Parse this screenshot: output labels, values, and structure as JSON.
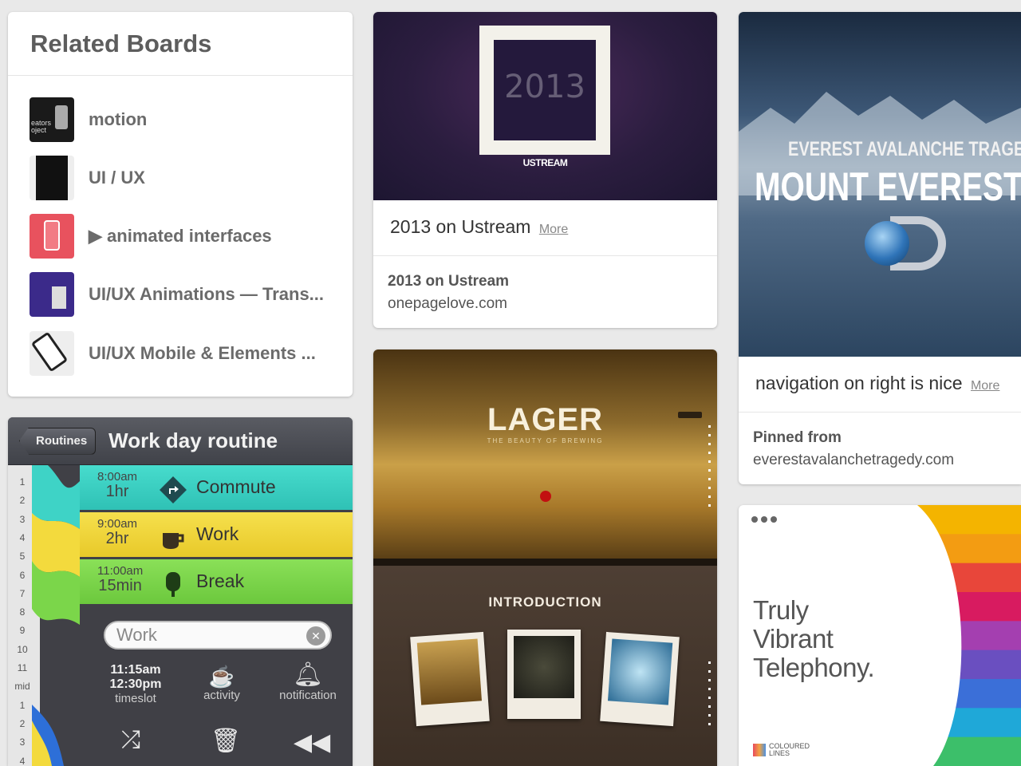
{
  "related_boards": {
    "title": "Related Boards",
    "items": [
      {
        "label": "motion",
        "thumb_text": "eators\noject"
      },
      {
        "label": "UI / UX"
      },
      {
        "label": "▶ animated interfaces"
      },
      {
        "label": "UI/UX Animations — Trans..."
      },
      {
        "label": "UI/UX Mobile & Elements ..."
      }
    ]
  },
  "routine": {
    "back_label": "Routines",
    "title": "Work day routine",
    "ruler": [
      "1",
      "2",
      "3",
      "4",
      "5",
      "6",
      "7",
      "8",
      "9",
      "10",
      "11",
      "mid",
      "1",
      "2",
      "3",
      "4"
    ],
    "rows": [
      {
        "time": "8:00am",
        "duration": "1hr",
        "name": "Commute",
        "color": "#3ed3c6"
      },
      {
        "time": "9:00am",
        "duration": "2hr",
        "name": "Work",
        "color": "#f3da3d"
      },
      {
        "time": "11:00am",
        "duration": "15min",
        "name": "Break",
        "color": "#7bd64a"
      }
    ],
    "search_value": "Work",
    "timeslot_start": "11:15am",
    "timeslot_end": "12:30pm",
    "timeslot_label": "timeslot",
    "activity_label": "activity",
    "notification_label": "notification"
  },
  "ustream": {
    "image_year": "2013",
    "image_logo": "USTREAM",
    "caption": "2013 on Ustream",
    "more": "More",
    "source_title": "2013 on Ustream",
    "source_domain": "onepagelove.com"
  },
  "lager": {
    "title": "LAGER",
    "subtitle": "THE BEAUTY OF BREWING",
    "intro": "INTRODUCTION"
  },
  "everest": {
    "line1": "EVEREST AVALANCHE TRAGED",
    "line2": "MOUNT EVEREST IN",
    "caption": "navigation on right is nice",
    "more": "More",
    "pinned_label": "Pinned from",
    "domain": "everestavalanchetragedy.com"
  },
  "coloured": {
    "headline": "Truly\nVibrant\nTelephony.",
    "logo": "COLOURED\nLINES",
    "stripe_colors": [
      "#f4b400",
      "#f39c12",
      "#e8463a",
      "#d81b60",
      "#a43fb0",
      "#6a4fc0",
      "#3b6fd8",
      "#1fa8d8",
      "#3cbf6a"
    ]
  }
}
